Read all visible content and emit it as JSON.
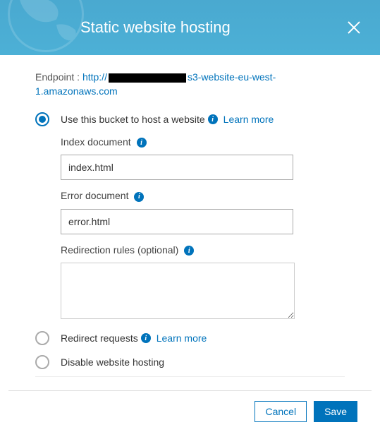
{
  "header": {
    "title": "Static website hosting"
  },
  "endpoint": {
    "label": "Endpoint : ",
    "url_prefix": "http://",
    "url_suffix": "s3-website-eu-west-1.amazonaws.com"
  },
  "options": {
    "host": {
      "label": "Use this bucket to host a website",
      "learn_more": "Learn more",
      "selected": true,
      "index_label": "Index document",
      "index_value": "index.html",
      "error_label": "Error document",
      "error_value": "error.html",
      "redirect_rules_label": "Redirection rules (optional)",
      "redirect_rules_value": ""
    },
    "redirect": {
      "label": "Redirect requests",
      "learn_more": "Learn more"
    },
    "disable": {
      "label": "Disable website hosting"
    }
  },
  "footer": {
    "cancel": "Cancel",
    "save": "Save"
  }
}
